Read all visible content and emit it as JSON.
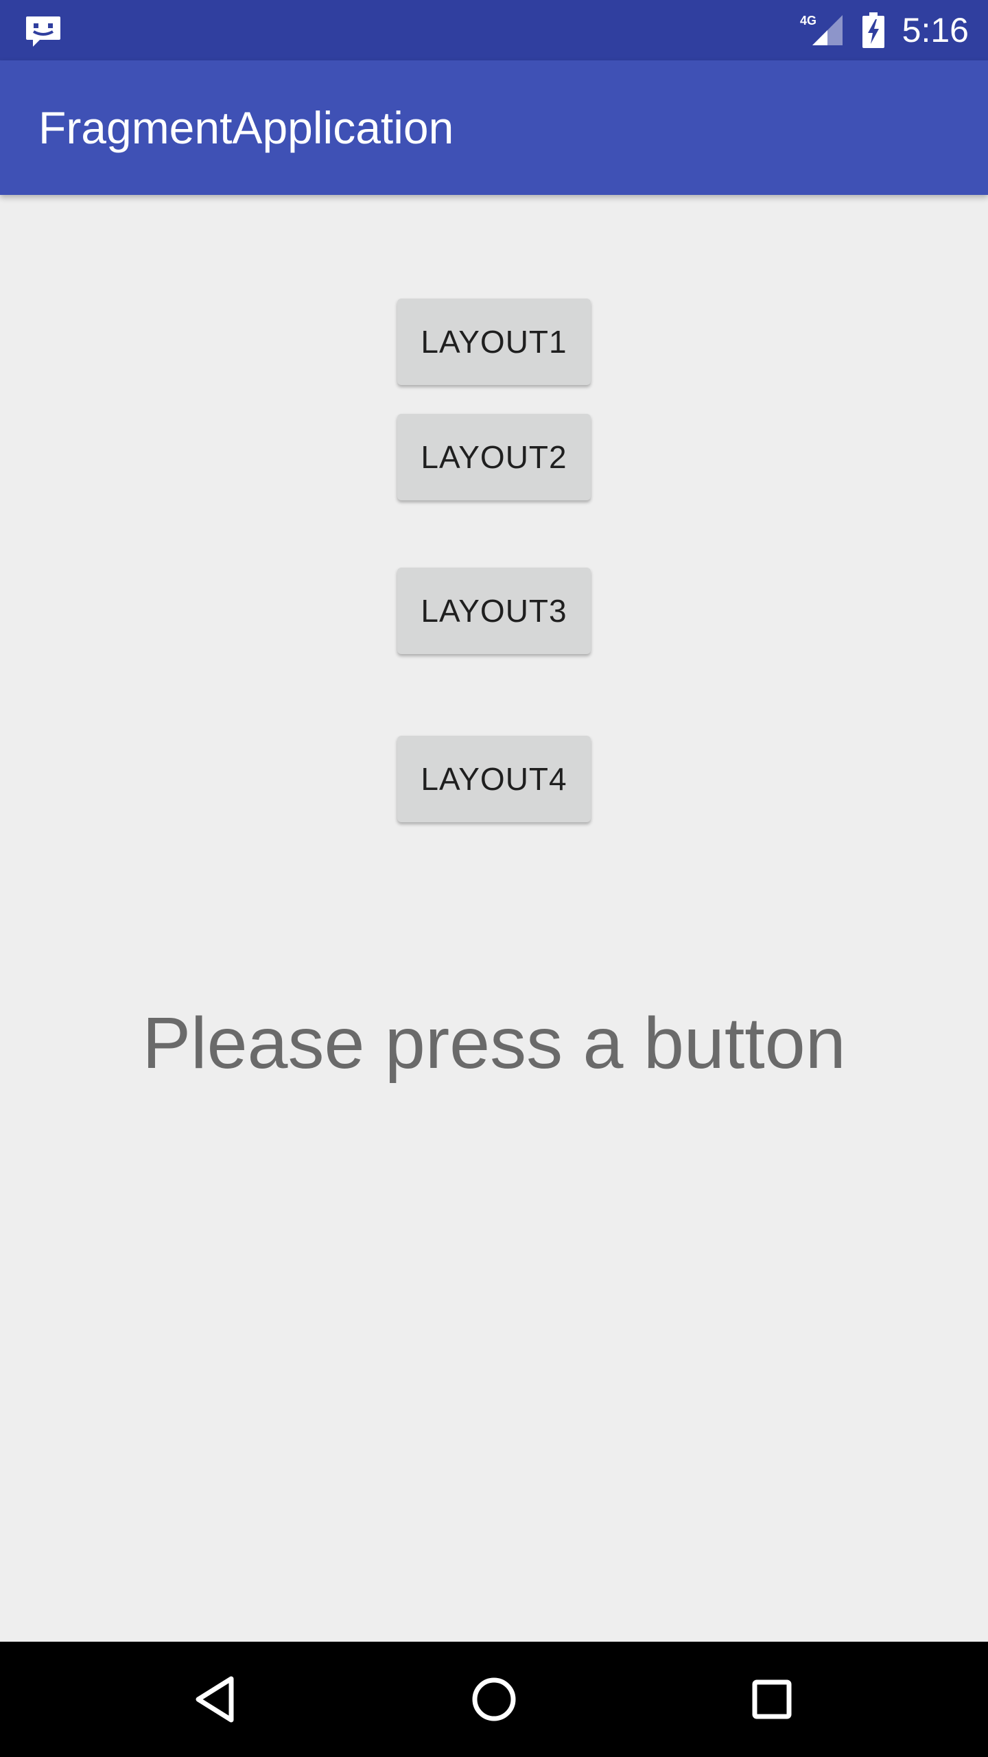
{
  "status_bar": {
    "time": "5:16",
    "network_label": "4G",
    "icons": {
      "notification": "chat-bubble-icon",
      "network": "cellular-signal-icon",
      "battery": "battery-charging-icon"
    }
  },
  "app_bar": {
    "title": "FragmentApplication",
    "color": "#3f51b5"
  },
  "buttons": [
    {
      "label": "LAYOUT1"
    },
    {
      "label": "LAYOUT2"
    },
    {
      "label": "LAYOUT3"
    },
    {
      "label": "LAYOUT4"
    }
  ],
  "message": "Please press a button",
  "nav_bar": {
    "icons": [
      "back-icon",
      "home-icon",
      "recents-icon"
    ]
  },
  "colors": {
    "status_bar": "#303f9f",
    "app_bar": "#3f51b5",
    "background": "#eeeeee",
    "button": "#d6d7d7"
  }
}
